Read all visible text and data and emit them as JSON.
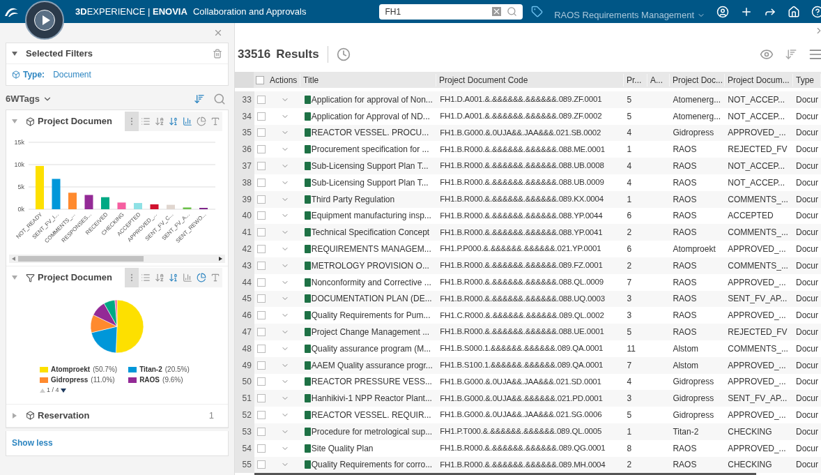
{
  "topbar": {
    "brand": "**3D**EXPERIENCE | **ENOVIA**",
    "app_title": "Collaboration and Approvals",
    "search": {
      "value": "FH1"
    },
    "workspace": "RAOS Requirements Management"
  },
  "filters_panel": {
    "selected_filters": {
      "title": "Selected Filters",
      "expanded": true,
      "filter": {
        "label": "Type:",
        "value": "Document"
      }
    },
    "tags_menu": "6WTags",
    "facets": [
      {
        "title": "Project Documen",
        "expanded": true,
        "kind": "bar",
        "chart_data": {
          "type": "bar",
          "categories": [
            "NOT_READY",
            "SENT_FV_I...",
            "COMMENTS_...",
            "RESPONSES...",
            "RECEIVED",
            "CHECKING",
            "ACCEPTED",
            "APPROVED_...",
            "SENT_FV_C...",
            "SENT_FV_A...",
            "SENT_REWO..."
          ],
          "series": [
            {
              "values": [
                9700,
                6800,
                3700,
                3200,
                2700,
                1500,
                1400,
                1100,
                1000,
                400,
                300
              ]
            }
          ],
          "colors": [
            "#fde000",
            "#0097d9",
            "#ff8a2e",
            "#932a96",
            "#00a984",
            "#f55fa0",
            "#8ee1e5",
            "#d0112e",
            "#e0d6cf",
            "#6cc04a",
            "#7a1e86"
          ],
          "ylim": [
            0,
            15000
          ],
          "yticks": [
            {
              "value": 0,
              "label": "0k"
            },
            {
              "value": 5000,
              "label": "5k"
            },
            {
              "value": 10000,
              "label": "10k"
            },
            {
              "value": 15000,
              "label": "15k"
            }
          ]
        }
      },
      {
        "title": "Project Documen",
        "expanded": true,
        "kind": "pie",
        "legend": [
          {
            "name": "Atomproekt",
            "share": "(50.7%)",
            "color": "#fde000"
          },
          {
            "name": "Titan-2",
            "share": "(20.5%)",
            "color": "#0097d9"
          },
          {
            "name": "Gidropress",
            "share": "(11.0%)",
            "color": "#ff8a2e"
          },
          {
            "name": "RAOS",
            "share": "(9.6%)",
            "color": "#932a96"
          }
        ],
        "pager": "1 / 4"
      },
      {
        "title": "Reservation",
        "expanded": false,
        "kind": "plain",
        "count": "1"
      }
    ],
    "show_less": "Show less"
  },
  "results": {
    "count": "33516",
    "label": "Results",
    "table": {
      "all_checked": false,
      "columns": [
        "Actions",
        "Title",
        "Project Document Code",
        "Pr...",
        "A...",
        "Project Doc...",
        "Project Docum...",
        "Type"
      ],
      "rows": [
        {
          "n": "33",
          "checked": false,
          "title": "Application for approval of Non...",
          "code": "FH1.D.A001.&.&&&&&&.&&&&&&.089.ZF.0001",
          "pr": "5",
          "org": "Atomenerg...",
          "status": "NOT_ACCEP...",
          "type": "Docur"
        },
        {
          "n": "34",
          "checked": false,
          "title": "Application for Approval of ND...",
          "code": "FH1.D.A001.&.&&&&&&.&&&&&&.089.ZF.0002",
          "pr": "5",
          "org": "Atomenerg...",
          "status": "NOT_ACCEP...",
          "type": "Docur"
        },
        {
          "n": "35",
          "checked": false,
          "title": "REACTOR VESSEL. PROCU...",
          "code": "FH1.B.G000.&.0UJA&&.JAA&&&.021.SB.0002",
          "pr": "4",
          "org": "Gidropress",
          "status": "APPROVED_...",
          "type": "Docur"
        },
        {
          "n": "36",
          "checked": false,
          "title": "Procurement specification for ...",
          "code": "FH1.B.R000.&.&&&&&&.&&&&&&.088.ME.0001",
          "pr": "1",
          "org": "RAOS",
          "status": "REJECTED_FV",
          "type": "Docur"
        },
        {
          "n": "37",
          "checked": false,
          "title": "Sub-Licensing Support Plan T...",
          "code": "FH1.B.R000.&.&&&&&&.&&&&&&.088.UB.0008",
          "pr": "4",
          "org": "RAOS",
          "status": "NOT_ACCEP...",
          "type": "Docur"
        },
        {
          "n": "38",
          "checked": false,
          "title": "Sub-Licensing Support Plan T...",
          "code": "FH1.B.R000.&.&&&&&&.&&&&&&.088.UB.0009",
          "pr": "4",
          "org": "RAOS",
          "status": "NOT_ACCEP...",
          "type": "Docur"
        },
        {
          "n": "39",
          "checked": false,
          "title": "Third Party Regulation",
          "code": "FH1.B.R000.&.&&&&&&.&&&&&&.089.KX.0004",
          "pr": "1",
          "org": "RAOS",
          "status": "COMMENTS_...",
          "type": "Docur"
        },
        {
          "n": "40",
          "checked": false,
          "title": "Equipment manufacturing insp...",
          "code": "FH1.B.R000.&.&&&&&&.&&&&&&.088.YP.0044",
          "pr": "6",
          "org": "RAOS",
          "status": "ACCEPTED",
          "type": "Docur"
        },
        {
          "n": "41",
          "checked": false,
          "title": "Technical Specification Concept",
          "code": "FH1.B.R000.&.&&&&&&.&&&&&&.088.YP.0041",
          "pr": "2",
          "org": "RAOS",
          "status": "COMMENTS_...",
          "type": "Docur"
        },
        {
          "n": "42",
          "checked": false,
          "title": "REQUIREMENTS MANAGEM...",
          "code": "FH1.P.P000.&.&&&&&&.&&&&&&.021.YP.0001",
          "pr": "6",
          "org": "Atomproekt",
          "status": "APPROVED_...",
          "type": "Docur"
        },
        {
          "n": "43",
          "checked": false,
          "title": "METROLOGY PROVISION O...",
          "code": "FH1.B.R000.&.&&&&&&.&&&&&&.089.FZ.0001",
          "pr": "2",
          "org": "RAOS",
          "status": "COMMENTS_...",
          "type": "Docur"
        },
        {
          "n": "44",
          "checked": false,
          "title": "Nonconformity and Corrective ...",
          "code": "FH1.B.R000.&.&&&&&&.&&&&&&.088.QL.0009",
          "pr": "7",
          "org": "RAOS",
          "status": "APPROVED_...",
          "type": "Docur"
        },
        {
          "n": "45",
          "checked": false,
          "title": "DOCUMENTATION PLAN (DE...",
          "code": "FH1.B.R000.&.&&&&&&.&&&&&&.088.UQ.0003",
          "pr": "3",
          "org": "RAOS",
          "status": "SENT_FV_AP...",
          "type": "Docur"
        },
        {
          "n": "46",
          "checked": false,
          "title": "Quality Requirements for Pum...",
          "code": "FH1.C.R000.&.&&&&&&.&&&&&&.089.QL.0002",
          "pr": "3",
          "org": "RAOS",
          "status": "APPROVED_...",
          "type": "Docur"
        },
        {
          "n": "47",
          "checked": false,
          "title": "Project Change Management ...",
          "code": "FH1.B.R000.&.&&&&&&.&&&&&&.088.UE.0001",
          "pr": "5",
          "org": "RAOS",
          "status": "REJECTED_FV",
          "type": "Docur"
        },
        {
          "n": "48",
          "checked": false,
          "title": "Quality assurance program (M...",
          "code": "FH1.B.S000.1.&&&&&&.&&&&&&.089.QA.0001",
          "pr": "11",
          "org": "Alstom",
          "status": "COMMENTS_...",
          "type": "Docur"
        },
        {
          "n": "49",
          "checked": false,
          "title": "AAEM Quality assurance progr...",
          "code": "FH1.B.S100.1.&&&&&&.&&&&&&.089.QA.0001",
          "pr": "7",
          "org": "Alstom",
          "status": "APPROVED_...",
          "type": "Docur"
        },
        {
          "n": "50",
          "checked": false,
          "title": "REACTOR PRESSURE VESS...",
          "code": "FH1.B.G000.&.0UJA&&.JAA&&&.021.SD.0001",
          "pr": "4",
          "org": "Gidropress",
          "status": "APPROVED_...",
          "type": "Docur"
        },
        {
          "n": "51",
          "checked": false,
          "title": "Hanhikivi-1 NPP Reactor Plant...",
          "code": "FH1.B.G000.&.0UJA&&.&&&&&&.021.PD.0001",
          "pr": "3",
          "org": "Gidropress",
          "status": "SENT_FV_AP...",
          "type": "Docur"
        },
        {
          "n": "52",
          "checked": false,
          "title": "REACTOR VESSEL. REQUIR...",
          "code": "FH1.B.G000.&.0UJA&&.JAA&&&.021.SG.0006",
          "pr": "5",
          "org": "Gidropress",
          "status": "APPROVED_...",
          "type": "Docur"
        },
        {
          "n": "53",
          "checked": false,
          "title": "Procedure for metrological sup...",
          "code": "FH1.P.T000.&.&&&&&&.&&&&&&.089.QL.0005",
          "pr": "1",
          "org": "Titan-2",
          "status": "CHECKING",
          "type": "Docur"
        },
        {
          "n": "54",
          "checked": false,
          "title": "Site Quality Plan",
          "code": "FH1.B.R000.&.&&&&&&.&&&&&&.089.QG.0001",
          "pr": "8",
          "org": "RAOS",
          "status": "APPROVED_...",
          "type": "Docur"
        },
        {
          "n": "55",
          "checked": false,
          "title": "Quality Requirements for corro...",
          "code": "FH1.B.R000.&.&&&&&&.&&&&&&.089.MH.0004",
          "pr": "2",
          "org": "RAOS",
          "status": "CHECKING",
          "type": "Docur"
        }
      ]
    }
  }
}
